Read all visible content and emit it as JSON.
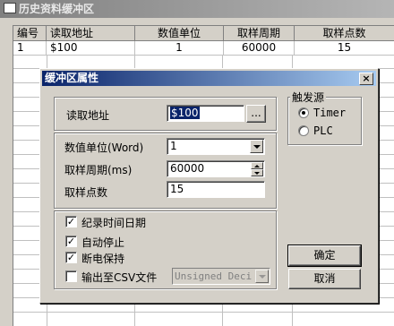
{
  "window": {
    "title": "历史资料缓冲区"
  },
  "grid": {
    "columns": [
      "编号",
      "读取地址",
      "数值单位",
      "取样周期",
      "取样点数"
    ],
    "rows": [
      [
        "1",
        "$100",
        "1",
        "60000",
        "15"
      ]
    ]
  },
  "dialog": {
    "title": "缓冲区属性",
    "close_label": "×",
    "address_label": "读取地址",
    "address_value": "$100",
    "browse_label": "...",
    "unit_label": "数值单位(Word)",
    "unit_value": "1",
    "period_label": "取样周期(ms)",
    "period_value": "60000",
    "points_label": "取样点数",
    "points_value": "15",
    "trigger_caption": "触发源",
    "trigger_options": [
      "Timer",
      "PLC"
    ],
    "trigger_selected": "Timer",
    "checkboxes": [
      {
        "label": "纪录时间日期",
        "checked": true
      },
      {
        "label": "自动停止",
        "checked": true
      },
      {
        "label": "断电保持",
        "checked": true
      },
      {
        "label": "输出至CSV文件",
        "checked": false
      }
    ],
    "csv_format_value": "Unsigned Deci",
    "ok_label": "确定",
    "cancel_label": "取消"
  }
}
